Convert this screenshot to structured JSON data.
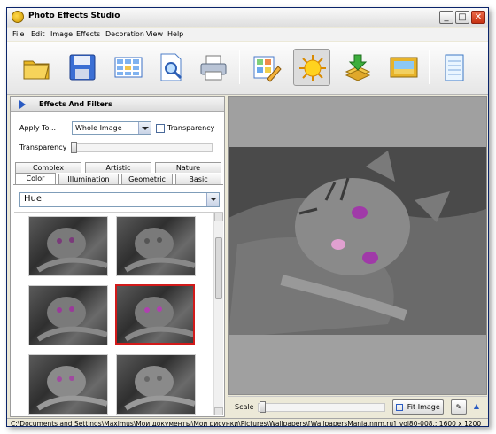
{
  "window": {
    "title": "Photo Effects Studio"
  },
  "title_buttons": {
    "minimize": "_",
    "maximize": "□",
    "close": "✕"
  },
  "menu": [
    "File",
    "Edit",
    "Image",
    "Effects",
    "Decoration",
    "View",
    "Help"
  ],
  "toolbar": {
    "buttons": [
      {
        "icon": "open-folder-icon"
      },
      {
        "icon": "save-disk-icon"
      },
      {
        "icon": "filmstrip-grid-icon"
      },
      {
        "icon": "print-preview-icon"
      },
      {
        "icon": "printer-icon"
      },
      {
        "icon": "edit-grid-pencil-icon"
      },
      {
        "icon": "sun-effects-icon",
        "active": true
      },
      {
        "icon": "layers-download-icon"
      },
      {
        "icon": "frame-picture-icon"
      },
      {
        "icon": "notepad-icon"
      }
    ]
  },
  "panel": {
    "title": "Effects And Filters",
    "apply_to_label": "Apply To...",
    "apply_to_value": "Whole Image",
    "transparency_checkbox_label": "Transparency",
    "transparency_label": "Transparency",
    "transparency_value": 0,
    "tabs_row1": [
      "Complex",
      "Artistic",
      "Nature"
    ],
    "tabs_row2": [
      "Color",
      "Illumination",
      "Geometric",
      "Basic"
    ],
    "selected_tab": "Color",
    "filter_value": "Hue",
    "selected_thumbnail": 3
  },
  "viewer": {
    "scale_label": "Scale",
    "fit_image_label": "Fit Image",
    "scale_value": 0
  },
  "status": {
    "path": "C:\\Documents and Settings\\Maximus\\Мои документы\\Мои рисунки\\Pictures\\Wallpapers\\[WallpapersMania.nnm.ru]_vol80-008.: 1600 x 1200"
  },
  "colors": {
    "accent": "#2a5bc2",
    "selection": "#d21a1a",
    "viewer_bg": "#a0a0a0"
  }
}
